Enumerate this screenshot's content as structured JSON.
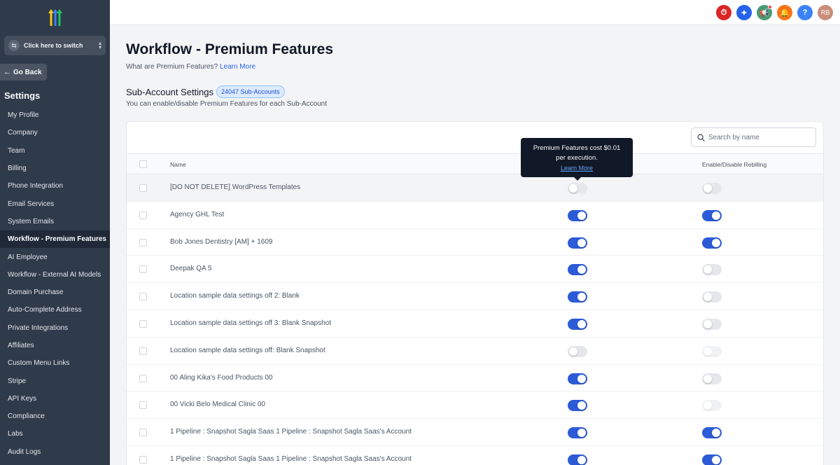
{
  "sidebar": {
    "switcher_label": "Click here to switch",
    "go_back": "Go Back",
    "settings_title": "Settings",
    "items": [
      {
        "label": "My Profile"
      },
      {
        "label": "Company"
      },
      {
        "label": "Team"
      },
      {
        "label": "Billing"
      },
      {
        "label": "Phone Integration"
      },
      {
        "label": "Email Services"
      },
      {
        "label": "System Emails"
      },
      {
        "label": "Workflow - Premium Features",
        "active": true
      },
      {
        "label": "AI Employee"
      },
      {
        "label": "Workflow - External AI Models"
      },
      {
        "label": "Domain Purchase"
      },
      {
        "label": "Auto-Complete Address"
      },
      {
        "label": "Private Integrations"
      },
      {
        "label": "Affiliates"
      },
      {
        "label": "Custom Menu Links"
      },
      {
        "label": "Stripe"
      },
      {
        "label": "API Keys"
      },
      {
        "label": "Compliance"
      },
      {
        "label": "Labs"
      },
      {
        "label": "Audit Logs"
      }
    ]
  },
  "topbar": {
    "icons": [
      {
        "name": "speedometer-icon",
        "color": "#dc2626",
        "glyph": "⏱"
      },
      {
        "name": "magic-wand-icon",
        "color": "#2563eb",
        "glyph": "✦"
      },
      {
        "name": "megaphone-icon",
        "color": "#4b9a73",
        "glyph": "📢"
      },
      {
        "name": "bell-icon",
        "color": "#f97316",
        "glyph": "🔔"
      },
      {
        "name": "help-icon",
        "color": "#3b82f6",
        "glyph": "?"
      }
    ],
    "avatar_initials": "RB",
    "avatar_color": "#c98e7a"
  },
  "main": {
    "page_title": "Workflow - Premium Features",
    "subtitle_prefix": "What are Premium Features?",
    "subtitle_link": "Learn More",
    "section_title": "Sub-Account Settings",
    "section_badge": "24047 Sub-Accounts",
    "section_desc": "You can enable/disable Premium Features for each Sub-Account",
    "search_placeholder": "Search by name",
    "columns": {
      "name": "Name",
      "rebilling": "Enable/Disable Rebilling"
    },
    "tooltip": {
      "line1": "Premium Features cost $0.01",
      "line2": "per execution.",
      "link": "Learn More"
    },
    "rows": [
      {
        "name": "[DO NOT DELETE] WordPress Templates",
        "premium": "off",
        "rebilling": "off",
        "hover": true
      },
      {
        "name": "Agency GHL Test",
        "premium": "on",
        "rebilling": "on"
      },
      {
        "name": "Bob Jones Dentistry [AM] + 1609",
        "premium": "on",
        "rebilling": "on"
      },
      {
        "name": "Deepak QA 5",
        "premium": "on",
        "rebilling": "off"
      },
      {
        "name": "Location sample data settings off 2: Blank",
        "premium": "on",
        "rebilling": "off"
      },
      {
        "name": "Location sample data settings off 3: Blank Snapshot",
        "premium": "on",
        "rebilling": "off"
      },
      {
        "name": "Location sample data settings off: Blank Snapshot",
        "premium": "off",
        "rebilling": "disabled"
      },
      {
        "name": "00 Aling Kika's Food Products 00",
        "premium": "on",
        "rebilling": "off"
      },
      {
        "name": "00 Vicki Belo Medical Clinic 00",
        "premium": "on",
        "rebilling": "disabled"
      },
      {
        "name": "1 Pipeline : Snapshot Sagla Saas 1 Pipeline : Snapshot Sagla Saas's Account",
        "premium": "on",
        "rebilling": "on"
      },
      {
        "name": "1 Pipeline : Snapshot Sagla Saas 1 Pipeline : Snapshot Sagla Saas's Account",
        "premium": "on",
        "rebilling": "on"
      }
    ]
  }
}
